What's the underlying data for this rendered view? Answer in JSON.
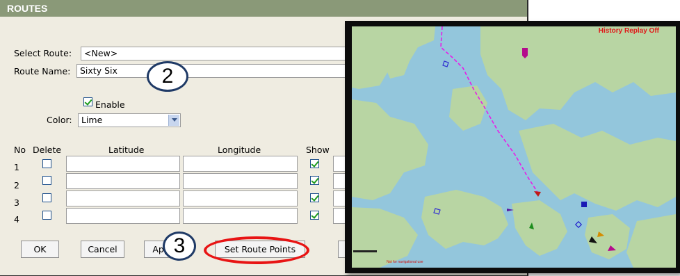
{
  "window": {
    "title": "ROUTES"
  },
  "form": {
    "select_route_label": "Select Route:",
    "select_route_value": "<New>",
    "route_name_label": "Route Name:",
    "route_name_value": "Sixty Six",
    "enable_label": "Enable",
    "enable_checked": true,
    "color_label": "Color:",
    "color_value": "Lime"
  },
  "table": {
    "headers": {
      "no": "No",
      "delete": "Delete",
      "latitude": "Latitude",
      "longitude": "Longitude",
      "show": "Show"
    },
    "rows": [
      {
        "no": "1",
        "delete": false,
        "latitude": "",
        "longitude": "",
        "show": true
      },
      {
        "no": "2",
        "delete": false,
        "latitude": "",
        "longitude": "",
        "show": true
      },
      {
        "no": "3",
        "delete": false,
        "latitude": "",
        "longitude": "",
        "show": true
      },
      {
        "no": "4",
        "delete": false,
        "latitude": "",
        "longitude": "",
        "show": true
      }
    ]
  },
  "buttons": {
    "ok": "OK",
    "cancel": "Cancel",
    "apply": "Apply",
    "set_route_points": "Set Route Points"
  },
  "callouts": {
    "two": "2",
    "three": "3"
  },
  "map": {
    "status": "History Replay Off",
    "colors": {
      "water": "#93c6dc",
      "land": "#b8d5a3",
      "route": "#e81ce8"
    }
  }
}
